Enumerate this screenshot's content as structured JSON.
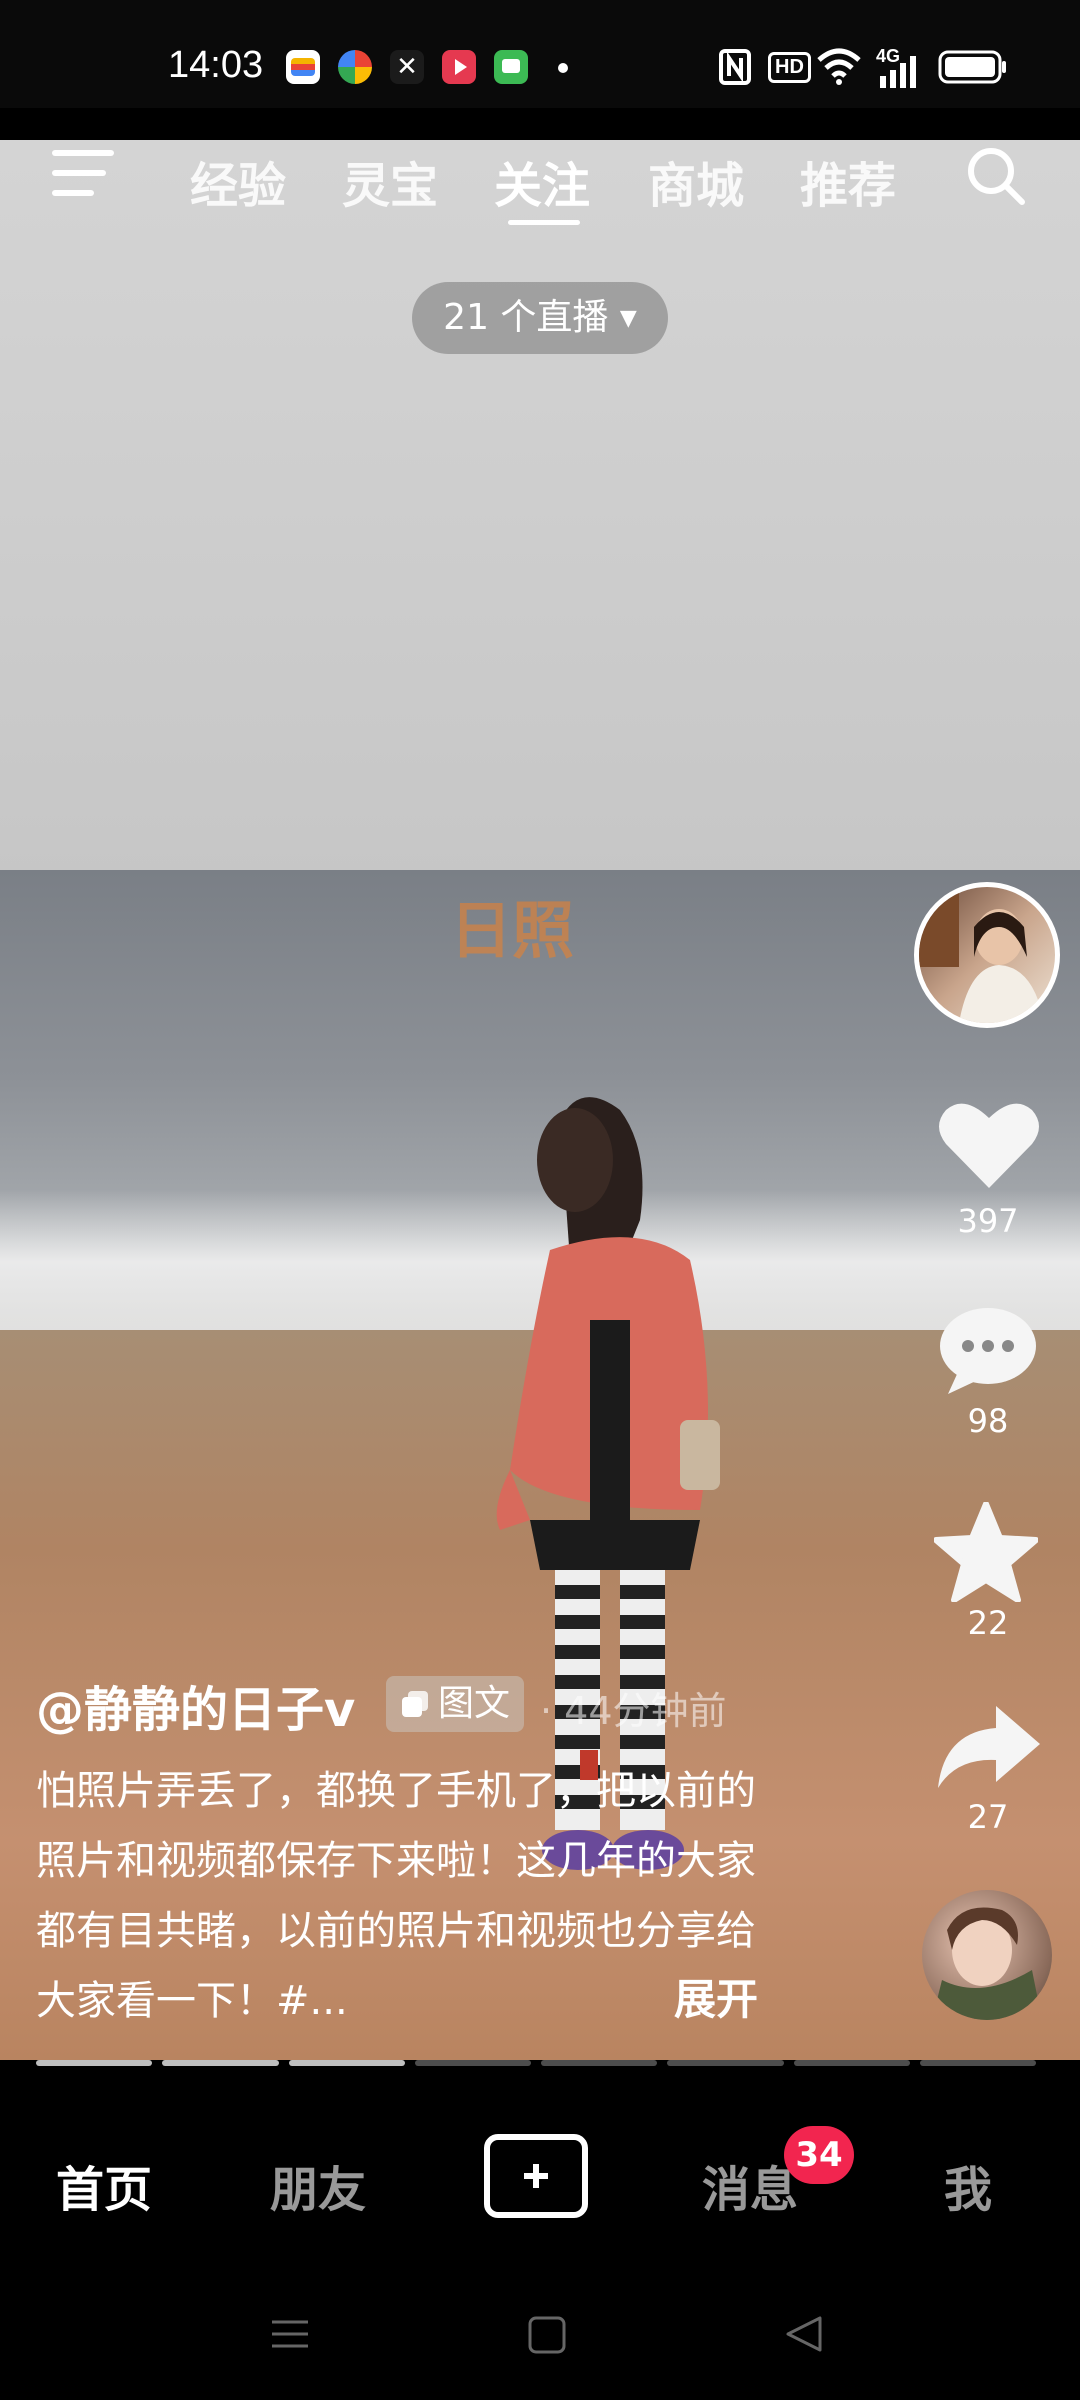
{
  "status_bar": {
    "time": "14:03",
    "network": "4G",
    "hd": "HD"
  },
  "top_nav": {
    "tabs": [
      "经验",
      "灵宝",
      "关注",
      "商城",
      "推荐"
    ],
    "active_tab": "关注",
    "live_count_label": "21 个直播"
  },
  "video": {
    "watermark": "日照"
  },
  "right_rail": {
    "likes": "397",
    "comments": "98",
    "favorites": "22",
    "shares": "27"
  },
  "post": {
    "username": "@静静的日子v",
    "type_label": "图文",
    "time_ago": "· 44分钟前",
    "caption": "怕照片弄丢了，都换了手机了，把以前的照片和视频都保存下来啦！这几年的大家都有目共睹，以前的照片和视频也分享给大家看一下！#...",
    "expand_label": "展开",
    "progress": {
      "total": 8,
      "done": 3
    }
  },
  "bottom_nav": {
    "home": "首页",
    "friends": "朋友",
    "messages": "消息",
    "messages_badge": "34",
    "me": "我",
    "active": "首页"
  },
  "colors": {
    "badge": "#f2254f",
    "coat": "#d86a5c",
    "watermark": "#f08228"
  }
}
